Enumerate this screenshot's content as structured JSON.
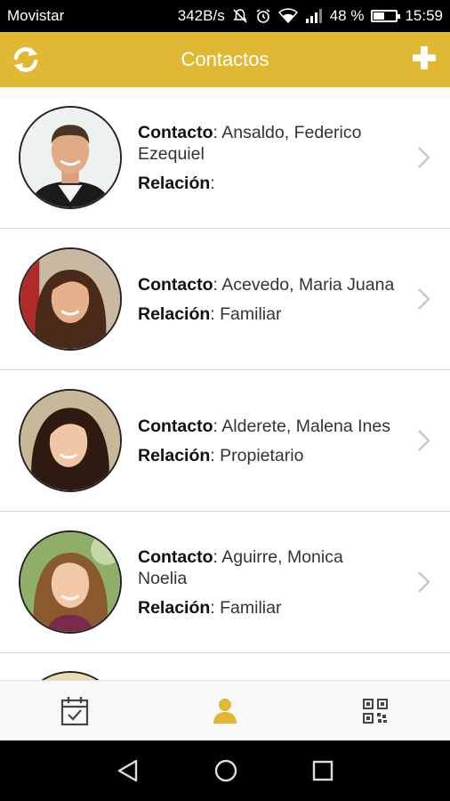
{
  "status_bar": {
    "carrier": "Movistar",
    "net_speed": "342B/s",
    "battery": "48 %",
    "battery_level": 0.48,
    "time": "15:59",
    "icons": [
      "mute-icon",
      "alarm-icon",
      "wifi-icon",
      "signal-icon",
      "battery-icon"
    ]
  },
  "app_bar": {
    "title": "Contactos",
    "left_icon": "refresh-icon",
    "right_icon": "add-icon",
    "color": "#e0b833"
  },
  "contacts": [
    {
      "contact_label": "Contacto",
      "name": "Ansaldo, Federico Ezequiel",
      "relation_label": "Relación",
      "relation": ""
    },
    {
      "contact_label": "Contacto",
      "name": "Acevedo, Maria Juana",
      "relation_label": "Relación",
      "relation": "Familiar"
    },
    {
      "contact_label": "Contacto",
      "name": "Alderete, Malena Ines",
      "relation_label": "Relación",
      "relation": "Propietario"
    },
    {
      "contact_label": "Contacto",
      "name": "Aguirre, Monica Noelia",
      "relation_label": "Relación",
      "relation": "Familiar"
    }
  ],
  "tabs": [
    {
      "icon": "calendar-icon",
      "active": false
    },
    {
      "icon": "person-icon",
      "active": true
    },
    {
      "icon": "qr-code-icon",
      "active": false
    }
  ],
  "nav_bar": {
    "icons": [
      "back-icon",
      "home-icon",
      "recents-icon"
    ]
  }
}
